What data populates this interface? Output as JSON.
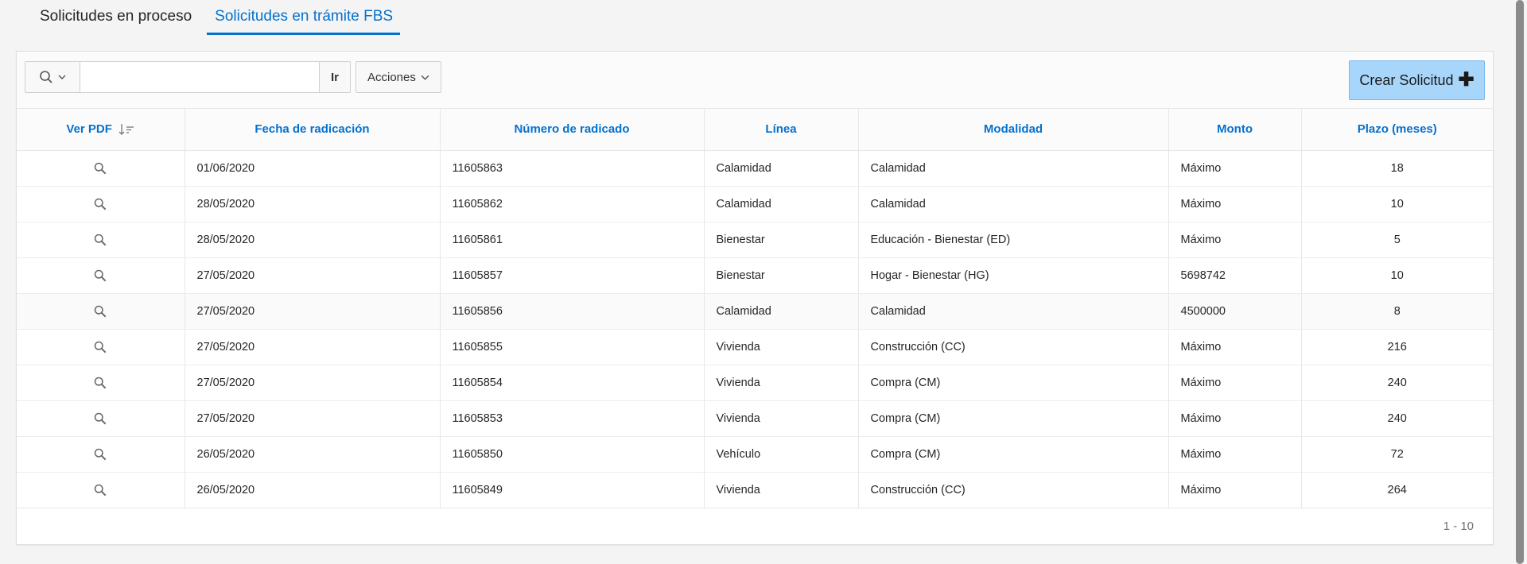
{
  "tabs": [
    {
      "label": "Solicitudes en proceso",
      "active": false
    },
    {
      "label": "Solicitudes en trámite FBS",
      "active": true
    }
  ],
  "toolbar": {
    "search_placeholder": "",
    "search_value": "",
    "go_label": "Ir",
    "actions_label": "Acciones",
    "create_label": "Crear Solicitud"
  },
  "table": {
    "columns": [
      "Ver PDF",
      "Fecha de radicación",
      "Número de radicado",
      "Línea",
      "Modalidad",
      "Monto",
      "Plazo (meses)"
    ],
    "rows": [
      {
        "fecha": "01/06/2020",
        "numero": "11605863",
        "linea": "Calamidad",
        "modalidad": "Calamidad",
        "monto": "Máximo",
        "plazo": "18"
      },
      {
        "fecha": "28/05/2020",
        "numero": "11605862",
        "linea": "Calamidad",
        "modalidad": "Calamidad",
        "monto": "Máximo",
        "plazo": "10"
      },
      {
        "fecha": "28/05/2020",
        "numero": "11605861",
        "linea": "Bienestar",
        "modalidad": "Educación - Bienestar (ED)",
        "monto": "Máximo",
        "plazo": "5"
      },
      {
        "fecha": "27/05/2020",
        "numero": "11605857",
        "linea": "Bienestar",
        "modalidad": "Hogar - Bienestar (HG)",
        "monto": "5698742",
        "plazo": "10"
      },
      {
        "fecha": "27/05/2020",
        "numero": "11605856",
        "linea": "Calamidad",
        "modalidad": "Calamidad",
        "monto": "4500000",
        "plazo": "8"
      },
      {
        "fecha": "27/05/2020",
        "numero": "11605855",
        "linea": "Vivienda",
        "modalidad": "Construcción (CC)",
        "monto": "Máximo",
        "plazo": "216"
      },
      {
        "fecha": "27/05/2020",
        "numero": "11605854",
        "linea": "Vivienda",
        "modalidad": "Compra (CM)",
        "monto": "Máximo",
        "plazo": "240"
      },
      {
        "fecha": "27/05/2020",
        "numero": "11605853",
        "linea": "Vivienda",
        "modalidad": "Compra (CM)",
        "monto": "Máximo",
        "plazo": "240"
      },
      {
        "fecha": "26/05/2020",
        "numero": "11605850",
        "linea": "Vehículo",
        "modalidad": "Compra (CM)",
        "monto": "Máximo",
        "plazo": "72"
      },
      {
        "fecha": "26/05/2020",
        "numero": "11605849",
        "linea": "Vivienda",
        "modalidad": "Construcción (CC)",
        "monto": "Máximo",
        "plazo": "264"
      }
    ]
  },
  "pagination": {
    "range": "1 - 10"
  },
  "colors": {
    "accent": "#0572ce",
    "create_button": "#a8d6fa"
  },
  "icons": {
    "search": "search-icon",
    "chevron": "chevron-down-icon",
    "sort": "sort-descending-icon",
    "plus": "plus-icon",
    "view_pdf": "magnifier-icon"
  }
}
